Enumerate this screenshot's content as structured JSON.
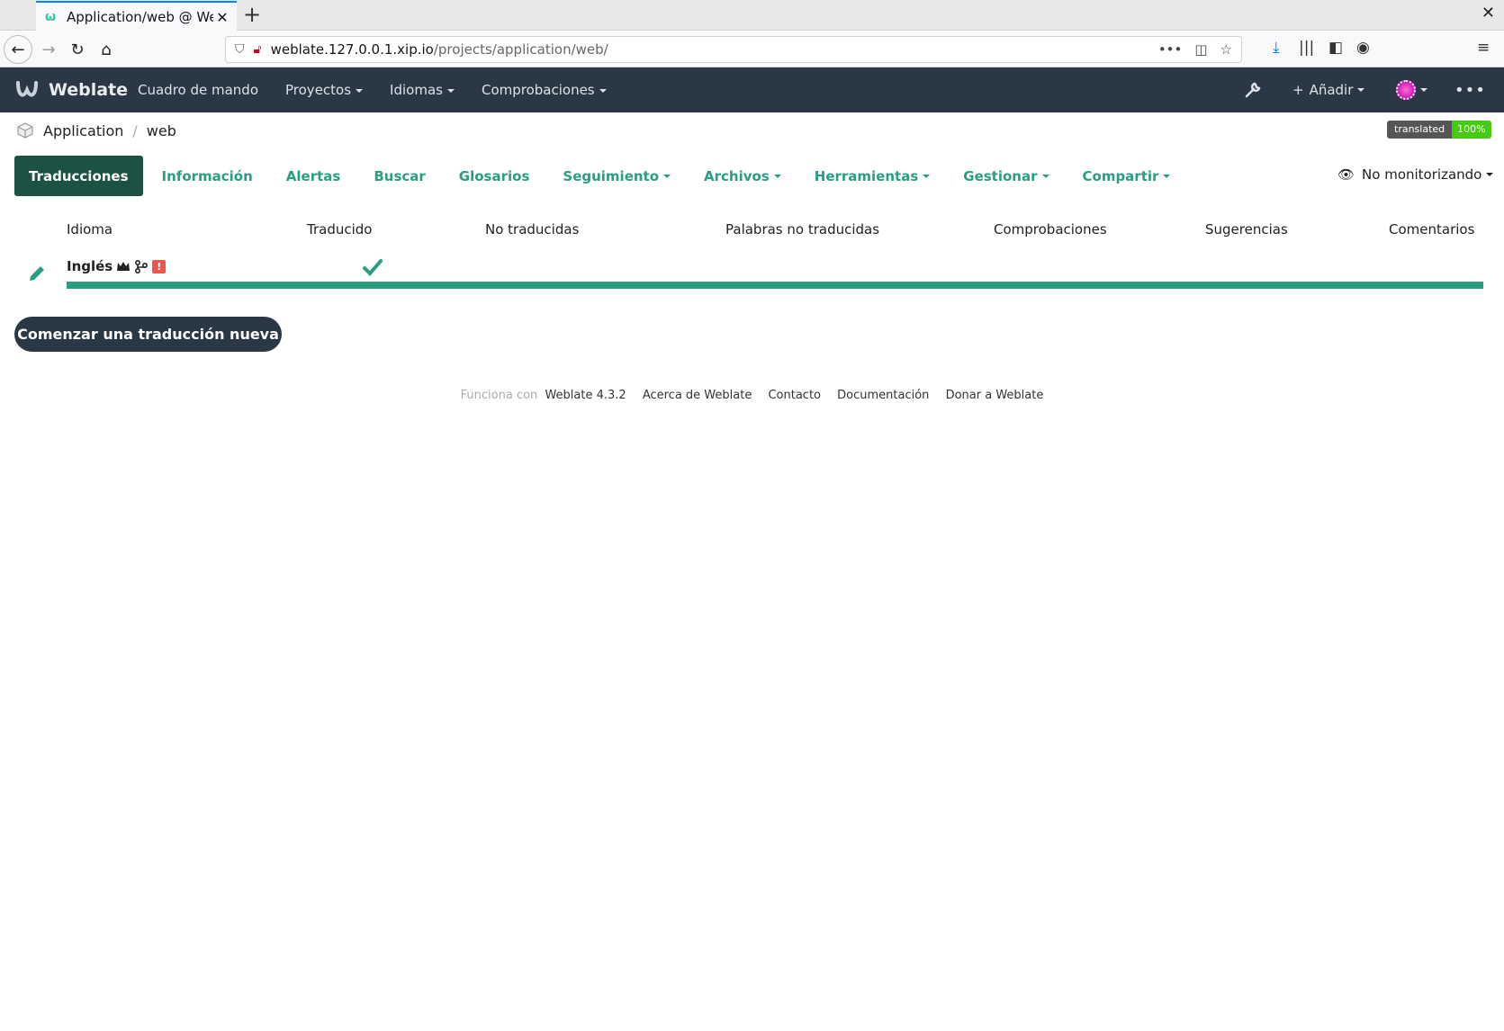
{
  "browser": {
    "tab_title": "Application/web @ Webl",
    "url_host": "weblate.127.0.0.1.xip.io",
    "url_path": "/projects/application/web/"
  },
  "header": {
    "brand": "Weblate",
    "nav": [
      "Cuadro de mando",
      "Proyectos",
      "Idiomas",
      "Comprobaciones"
    ],
    "add_label": "Añadir"
  },
  "breadcrumb": {
    "project": "Application",
    "component": "web"
  },
  "badge": {
    "label": "translated",
    "value": "100%"
  },
  "tabs": [
    "Traducciones",
    "Información",
    "Alertas",
    "Buscar",
    "Glosarios",
    "Seguimiento",
    "Archivos",
    "Herramientas",
    "Gestionar",
    "Compartir"
  ],
  "watch_label": "No monitorizando",
  "table": {
    "columns": [
      "Idioma",
      "Traducido",
      "No traducidas",
      "Palabras no traducidas",
      "Comprobaciones",
      "Sugerencias",
      "Comentarios"
    ],
    "rows": [
      {
        "language": "Inglés",
        "translated_percent": 100
      }
    ]
  },
  "start_button": "Comenzar una traducción nueva",
  "footer": {
    "powered_prefix": "Funciona con",
    "links": [
      "Weblate 4.3.2",
      "Acerca de Weblate",
      "Contacto",
      "Documentación",
      "Donar a Weblate"
    ]
  },
  "colors": {
    "accent": "#2a9d83",
    "header_bg": "#2a3744",
    "active_tab": "#1c5244"
  }
}
